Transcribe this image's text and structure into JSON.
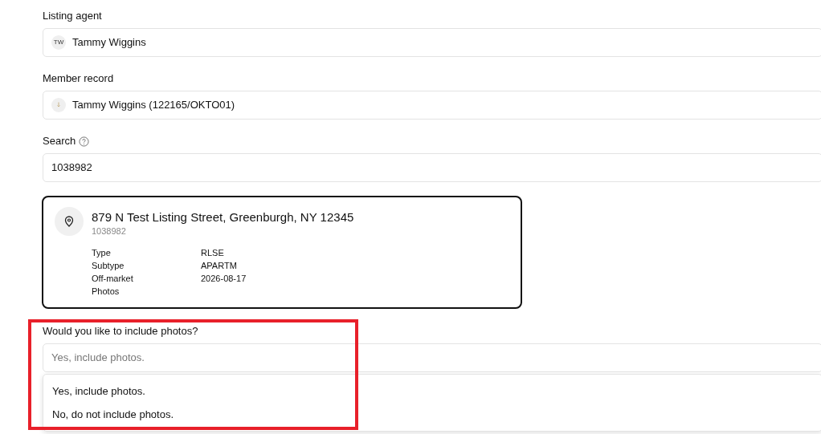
{
  "fields": [
    {
      "kind": "avatar",
      "label": "Listing agent",
      "initials": "TW",
      "value": "Tammy Wiggins"
    },
    {
      "kind": "record",
      "label": "Member record",
      "value": "Tammy Wiggins (122165/OKTO01)"
    },
    {
      "kind": "search",
      "label": "Search",
      "help": true,
      "value": "1038982"
    }
  ],
  "listing": {
    "address": "879 N Test Listing Street, Greenburgh, NY 12345",
    "id": "1038982",
    "details": [
      {
        "label": "Type",
        "value": "RLSE"
      },
      {
        "label": "Subtype",
        "value": "APARTM"
      },
      {
        "label": "Off-market",
        "value": "2026-08-17"
      },
      {
        "label": "Photos"
      }
    ]
  },
  "photos_question": {
    "label": "Would you like to include photos?",
    "placeholder": "Yes, include photos.",
    "expanded": true,
    "options": [
      "Yes, include photos.",
      "No, do not include photos."
    ]
  },
  "highlight": {
    "color": "#e8202a"
  }
}
